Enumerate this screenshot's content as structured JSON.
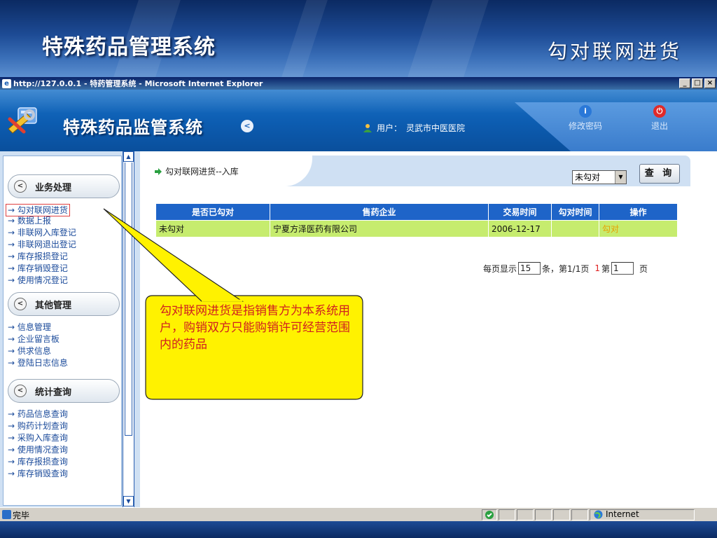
{
  "slide": {
    "title": "特殊药品管理系统",
    "subtitle": "勾对联网进货"
  },
  "window": {
    "title": "http://127.0.0.1 - 特药管理系统 - Microsoft Internet Explorer",
    "minimize": "_",
    "maximize": "□",
    "close": "×"
  },
  "app": {
    "title": "特殊药品监管系统",
    "user_label": "用户：",
    "user_name": "灵武市中医医院",
    "change_password": "修改密码",
    "logout": "退出"
  },
  "sidebar": {
    "sections": [
      {
        "title": "业务处理",
        "items": [
          "勾对联网进货",
          "数据上报",
          "非联网入库登记",
          "非联网退出登记",
          "库存报损登记",
          "库存销毁登记",
          "使用情况登记"
        ]
      },
      {
        "title": "其他管理",
        "items": [
          "信息管理",
          "企业留言板",
          "供求信息",
          "登陆日志信息"
        ]
      },
      {
        "title": "统计查询",
        "items": [
          "药品信息查询",
          "购药计划查询",
          "采购入库查询",
          "使用情况查询",
          "库存报损查询",
          "库存销毁查询"
        ]
      }
    ]
  },
  "main": {
    "breadcrumb": "勾对联网进货--入库",
    "filter_value": "未勾对",
    "query_label": "查 询",
    "columns": [
      "是否已勾对",
      "售药企业",
      "交易时间",
      "勾对时间",
      "操作"
    ],
    "rows": [
      {
        "matched": "未勾对",
        "company": "宁夏方泽医药有限公司",
        "trade_time": "2006-12-17",
        "match_time": "",
        "action": "勾对"
      }
    ],
    "pager": {
      "per_page_label": "每页显示",
      "per_page_value": "15",
      "summary": "条，第1/1页",
      "current_page_marker": "1",
      "goto_label": "第",
      "goto_value": "1",
      "page_suffix": "页"
    }
  },
  "callout": {
    "text": "勾对联网进货是指销售方为本系统用户，购销双方只能购销许可经营范围内的药品"
  },
  "status": {
    "text": "完毕",
    "zone": "Internet"
  },
  "colors": {
    "header_blue": "#0c5cb0",
    "table_header": "#1e64c8",
    "row_green": "#c6ec6e",
    "callout_yellow": "#fff200",
    "callout_text": "#d02020"
  }
}
